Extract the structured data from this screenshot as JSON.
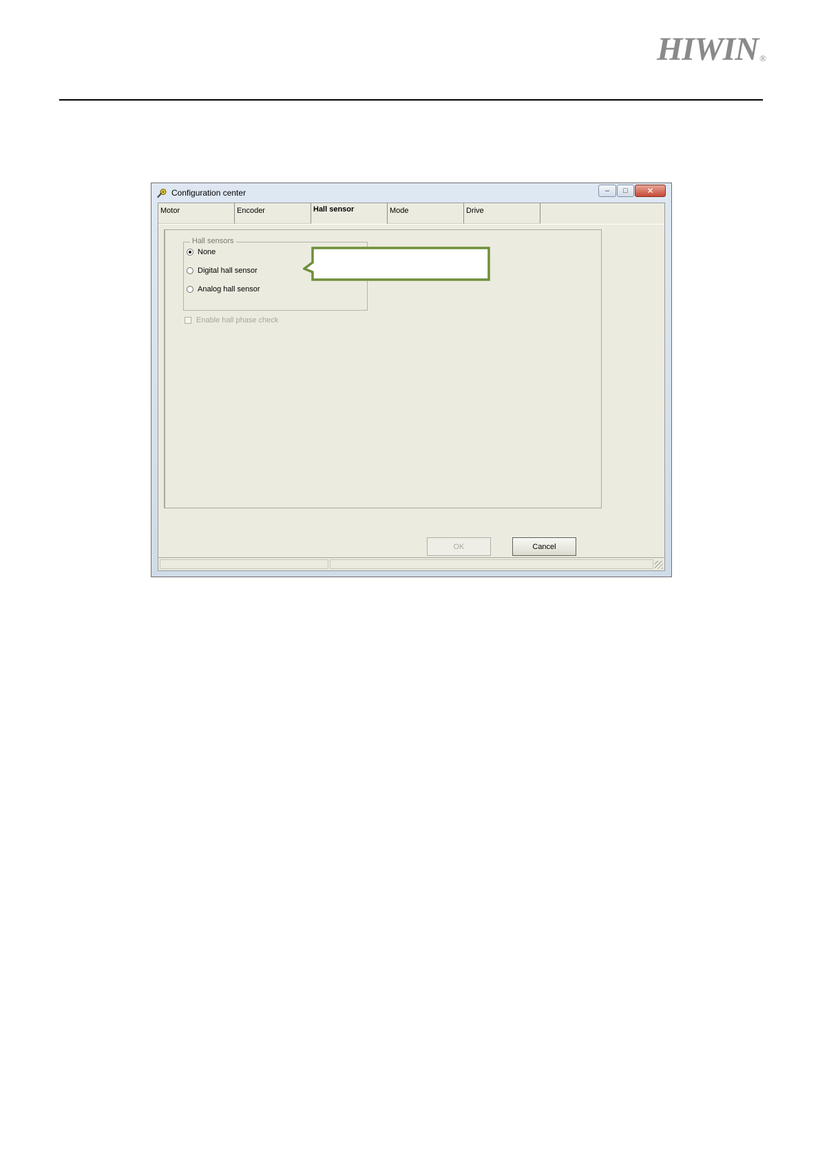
{
  "header": {
    "logo_text": "HIWIN",
    "logo_reg": "®"
  },
  "window": {
    "title": "Configuration center",
    "caption": {
      "minimize": "–",
      "maximize": "□",
      "close": "✕"
    }
  },
  "tabs": [
    {
      "label": "Motor",
      "active": false
    },
    {
      "label": "Encoder",
      "active": false
    },
    {
      "label": "Hall sensor",
      "active": true
    },
    {
      "label": "Mode",
      "active": false
    },
    {
      "label": "Drive",
      "active": false
    }
  ],
  "hall_sensors": {
    "title": "Hall sensors",
    "options": [
      {
        "label": "None",
        "checked": true
      },
      {
        "label": "Digital hall sensor",
        "checked": false
      },
      {
        "label": "Analog hall sensor",
        "checked": false
      }
    ]
  },
  "phase_check": {
    "label": "Enable hall phase check",
    "enabled": false,
    "checked": false
  },
  "buttons": {
    "ok": "OK",
    "cancel": "Cancel"
  },
  "colors": {
    "callout_border": "#6f8f3c",
    "accent_logo": "#8a8a8a"
  },
  "icons": {
    "app": "configuration-icon",
    "grip": "resize-grip-icon"
  }
}
